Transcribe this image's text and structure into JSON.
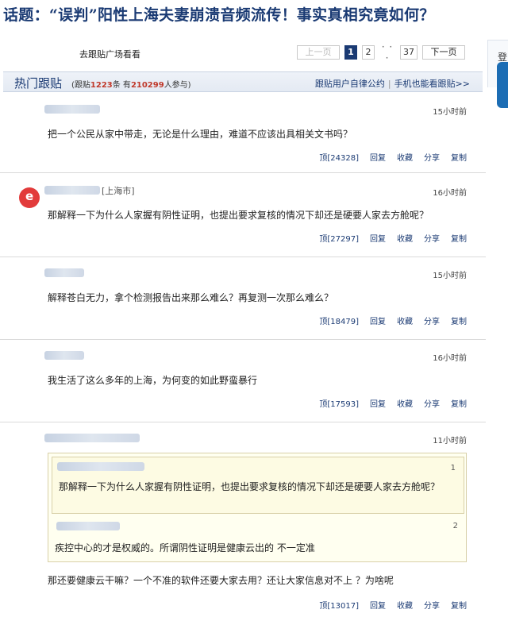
{
  "topic": {
    "prefix": "话题：",
    "open_quote": "“误判”",
    "rest": "阳性上海夫妻崩溃音频流传！事实真相究竟如何？"
  },
  "toolbar": {
    "goto_plaza": "去跟贴广场看看",
    "prev": "上一页",
    "pages": [
      "1",
      "2"
    ],
    "ellipsis": "· · ·",
    "last_page": "37",
    "next": "下一页"
  },
  "side": {
    "login": "登"
  },
  "hot": {
    "title": "热门跟贴",
    "stats_prefix": "(跟贴",
    "reply_count": "1223",
    "stats_mid": "条 有",
    "participant_count": "210299",
    "stats_suffix": "人参与)",
    "link_pledge": "跟贴用户自律公约",
    "link_mobile": "手机也能看跟贴>>"
  },
  "actions": {
    "reply": "回复",
    "favorite": "收藏",
    "share": "分享",
    "copy": "复制"
  },
  "comments": [
    {
      "time": "15小时前",
      "text": "把一个公民从家中带走，无论是什么理由，难道不应该出具相关文书吗？",
      "up": "顶[24328]"
    },
    {
      "location": "[上海市]",
      "time": "16小时前",
      "text": "那解释一下为什么人家握有阴性证明，也提出要求复核的情况下却还是硬要人家去方舱呢？",
      "up": "顶[27297]"
    },
    {
      "time": "15小时前",
      "text": "解释苍白无力，拿个检测报告出来那么难么？再复测一次那么难么？",
      "up": "顶[18479]"
    },
    {
      "time": "16小时前",
      "text": "我生活了这么多年的上海，为何变的如此野蛮暴行",
      "up": "顶[17593]"
    },
    {
      "time": "11小时前",
      "quotes": [
        {
          "num": "1",
          "text": "那解释一下为什么人家握有阴性证明，也提出要求复核的情况下却还是硬要人家去方舱呢？"
        },
        {
          "num": "2",
          "text": "疾控中心的才是权威的。所谓阴性证明是健康云出的 不一定准"
        }
      ],
      "text": "那还要健康云干嘛？一个不准的软件还要大家去用？还让大家信息对不上 ？为啥呢",
      "up": "顶[13017]"
    }
  ]
}
